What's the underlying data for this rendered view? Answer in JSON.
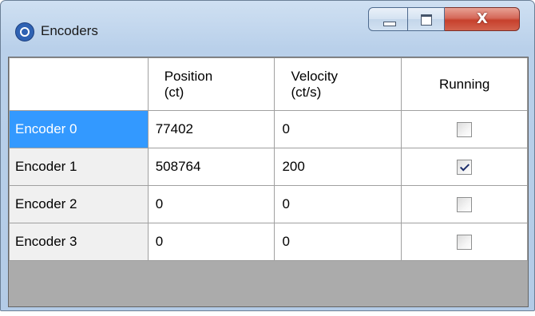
{
  "window": {
    "title": "Encoders",
    "icon": "app-logo-icon",
    "controls": {
      "minimize": "minimize-icon",
      "maximize": "maximize-icon",
      "close": "X"
    }
  },
  "grid": {
    "columns": [
      {
        "line1": "",
        "line2": ""
      },
      {
        "line1": "Position",
        "line2": "(ct)"
      },
      {
        "line1": "Velocity",
        "line2": "(ct/s)"
      },
      {
        "line1": "Running",
        "line2": ""
      }
    ],
    "rows": [
      {
        "name": "Encoder 0",
        "position": "77402",
        "velocity": "0",
        "running": false,
        "selected": true
      },
      {
        "name": "Encoder 1",
        "position": "508764",
        "velocity": "200",
        "running": true,
        "selected": false
      },
      {
        "name": "Encoder 2",
        "position": "0",
        "velocity": "0",
        "running": false,
        "selected": false
      },
      {
        "name": "Encoder 3",
        "position": "0",
        "velocity": "0",
        "running": false,
        "selected": false
      }
    ]
  },
  "colors": {
    "selection": "#3399ff",
    "grid_background": "#ababab",
    "close_button": "#c7402c"
  }
}
